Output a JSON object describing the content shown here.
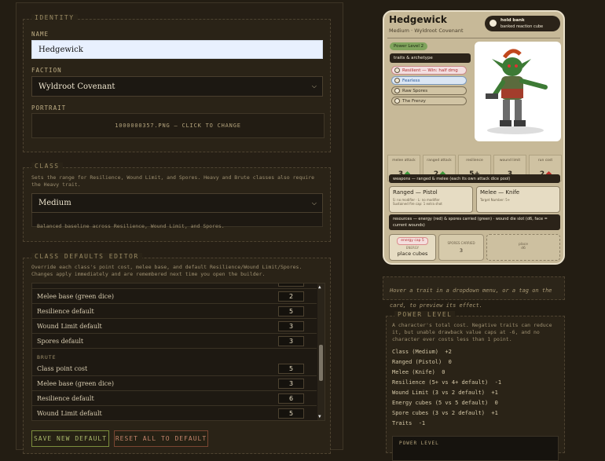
{
  "identity": {
    "legend": "IDENTITY",
    "name_label": "NAME",
    "name_value": "Hedgewick",
    "faction_label": "FACTION",
    "faction_value": "Wyldroot Covenant",
    "portrait_label": "PORTRAIT",
    "portrait_value": "1000000357.PNG — CLICK TO CHANGE"
  },
  "class": {
    "legend": "CLASS",
    "hint": "Sets the range for Resilience, Wound Limit, and Spores. Heavy and Brute classes also require the Heavy trait.",
    "selected": "Medium",
    "description": "Balanced baseline across Resilience, Wound Limit, and Spores."
  },
  "editor": {
    "legend": "CLASS DEFAULTS EDITOR",
    "hint": "Override each class's point cost, melee base, and default Resilience/Wound Limit/Spores. Changes apply immediately and are remembered next time you open the builder.",
    "rows": [
      {
        "label": "Melee base (green dice)",
        "value": "2"
      },
      {
        "label": "Resilience default",
        "value": "5"
      },
      {
        "label": "Wound Limit default",
        "value": "3"
      },
      {
        "label": "Spores default",
        "value": "3"
      }
    ],
    "group2": "BRUTE",
    "rows2": [
      {
        "label": "Class point cost",
        "value": "5"
      },
      {
        "label": "Melee base (green dice)",
        "value": "3"
      },
      {
        "label": "Resilience default",
        "value": "6"
      },
      {
        "label": "Wound Limit default",
        "value": "5"
      }
    ],
    "save_label": "SAVE NEW DEFAULT",
    "reset_label": "RESET ALL TO DEFAULT"
  },
  "card": {
    "name": "Hedgewick",
    "subtitle": "Medium · Wyldroot Covenant",
    "hold_title": "hold bank",
    "hold_sub": "banked reaction cube",
    "power_badge": "Power Level 2",
    "traits_header": "traits & archetype",
    "traits": [
      "Resilient — Win: half dmg",
      "Fearless",
      "Raw Spores",
      "The Frenzy"
    ],
    "stats": [
      {
        "label": "melee attack",
        "value": "3"
      },
      {
        "label": "ranged attack",
        "value": "2"
      },
      {
        "label": "resilience",
        "value": "5+"
      },
      {
        "label": "wound limit",
        "value": "3"
      },
      {
        "label": "run cost",
        "value": "2"
      }
    ],
    "weapons_header": "weapons — ranged & melee (each its own attack dice pool)",
    "ranged_title": "Ranged — Pistol",
    "ranged_line1": "S: no modifier · L: no modifier",
    "ranged_line2": "Sustained fire cap: 1 extra shot",
    "melee_title": "Melee — Knife",
    "melee_line1": "Target Number: 5+",
    "resources_header": "resources — energy (red) & spores carried (green) · wound die slot (d6, face = current wounds)",
    "energy_cap": "energy cap 5",
    "energy_label": "ENERGY",
    "energy_value": "place cubes",
    "spores_label": "SPORES CARRIED",
    "spores_value": "3",
    "wound_label": "place",
    "wound_sub": "d6"
  },
  "hint_box": "Hover a trait in a dropdown menu, or a tag on the card, to preview its effect.",
  "power": {
    "legend": "POWER LEVEL",
    "desc": "A character's total cost. Negative traits can reduce it, but unable drawback value caps at -6, and no character ever costs less than 1 point.",
    "lines": [
      "Class (Medium)  +2",
      "Ranged (Pistol)  0",
      "Melee (Knife)  0",
      "Resilience (5+ vs 4+ default)  -1",
      "Wound Limit (3 vs 2 default)  +1",
      "Energy cubes (5 vs 5 default)  0",
      "Spore cubes (3 vs 2 default)  +1",
      "Traits  -1"
    ],
    "footer": "POWER LEVEL"
  },
  "colors": {
    "accent_green": "#3f9a3c",
    "accent_red": "#c0302b",
    "text_gold": "#c9b990"
  }
}
